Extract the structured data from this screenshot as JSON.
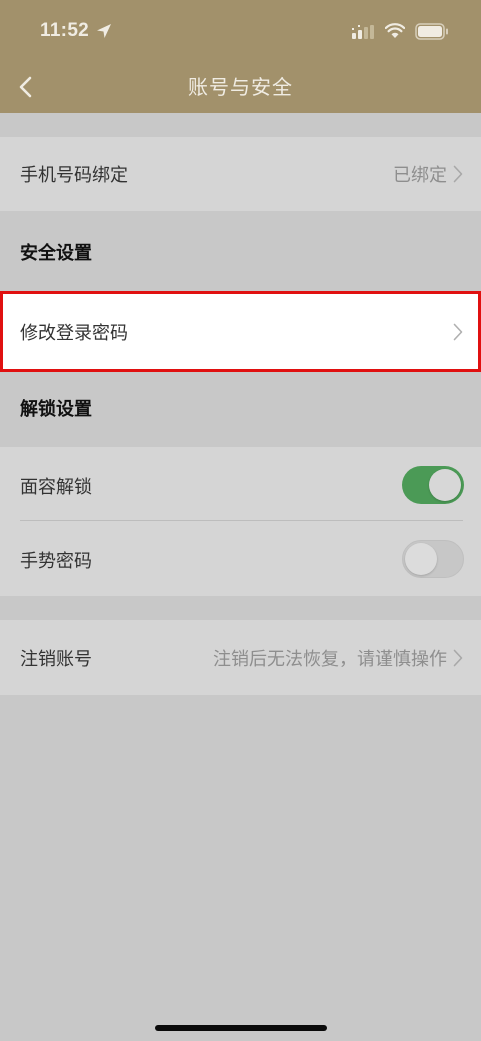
{
  "status_bar": {
    "time": "11:52"
  },
  "nav": {
    "title": "账号与安全"
  },
  "phone_binding": {
    "label": "手机号码绑定",
    "value": "已绑定"
  },
  "security_section": {
    "title": "安全设置",
    "change_password_label": "修改登录密码"
  },
  "unlock_section": {
    "title": "解锁设置",
    "face_unlock": {
      "label": "面容解锁",
      "enabled": true
    },
    "gesture_password": {
      "label": "手势密码",
      "enabled": false
    }
  },
  "cancel_account": {
    "label": "注销账号",
    "value": "注销后无法恢复，请谨慎操作"
  },
  "colors": {
    "header_bg": "#a2916b",
    "page_bg": "#c8c8c8",
    "row_bg": "#d5d5d5",
    "highlight_border": "#e01010",
    "toggle_on": "#4b9a56"
  },
  "icons": {
    "location": "location-arrow-icon",
    "signal": "cellular-signal-icon",
    "wifi": "wifi-icon",
    "battery": "battery-icon",
    "back": "chevron-left-icon",
    "chevron": "chevron-right-icon"
  }
}
